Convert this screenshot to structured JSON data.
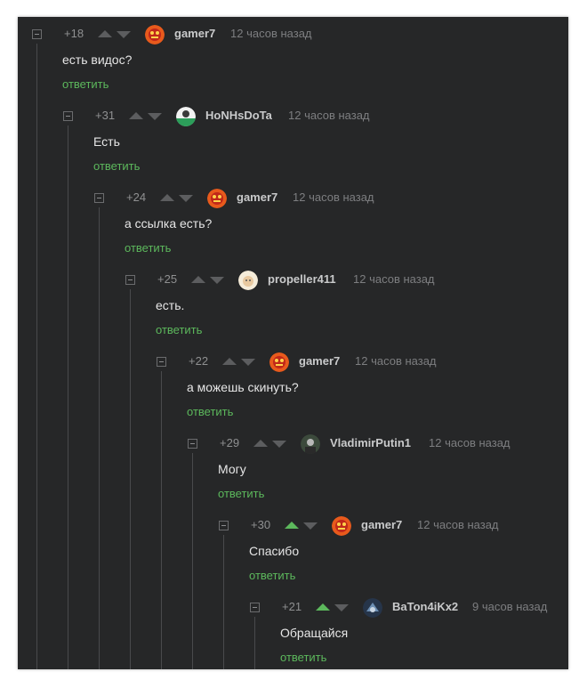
{
  "comments": [
    {
      "rating": "+18",
      "username": "gamer7",
      "time": "12 часов назад",
      "text": "есть видос?",
      "reply": "ответить",
      "avatar": "gamer7-avatar",
      "upvoted": false
    },
    {
      "rating": "+31",
      "username": "HoNHsDoTa",
      "time": "12 часов назад",
      "text": "Есть",
      "reply": "ответить",
      "avatar": "honhsdota-avatar",
      "upvoted": false
    },
    {
      "rating": "+24",
      "username": "gamer7",
      "time": "12 часов назад",
      "text": "а ссылка есть?",
      "reply": "ответить",
      "avatar": "gamer7-avatar",
      "upvoted": false
    },
    {
      "rating": "+25",
      "username": "propeller411",
      "time": "12 часов назад",
      "text": "есть.",
      "reply": "ответить",
      "avatar": "propeller411-avatar",
      "upvoted": false
    },
    {
      "rating": "+22",
      "username": "gamer7",
      "time": "12 часов назад",
      "text": "а можешь скинуть?",
      "reply": "ответить",
      "avatar": "gamer7-avatar",
      "upvoted": false
    },
    {
      "rating": "+29",
      "username": "VladimirPutin1",
      "time": "12 часов назад",
      "text": "Могу",
      "reply": "ответить",
      "avatar": "vladimirputin1-avatar",
      "upvoted": false
    },
    {
      "rating": "+30",
      "username": "gamer7",
      "time": "12 часов назад",
      "text": "Спасибо",
      "reply": "ответить",
      "avatar": "gamer7-avatar",
      "upvoted": true
    },
    {
      "rating": "+21",
      "username": "BaTon4iKx2",
      "time": "9 часов назад",
      "text": "Обращайся",
      "reply": "ответить",
      "avatar": "baton4ikx2-avatar",
      "upvoted": true
    }
  ],
  "colors": {
    "background": "#262728",
    "reply_link": "#5cb85c",
    "upvote_active": "#5cb85c",
    "thread_line": "#494a4c"
  }
}
